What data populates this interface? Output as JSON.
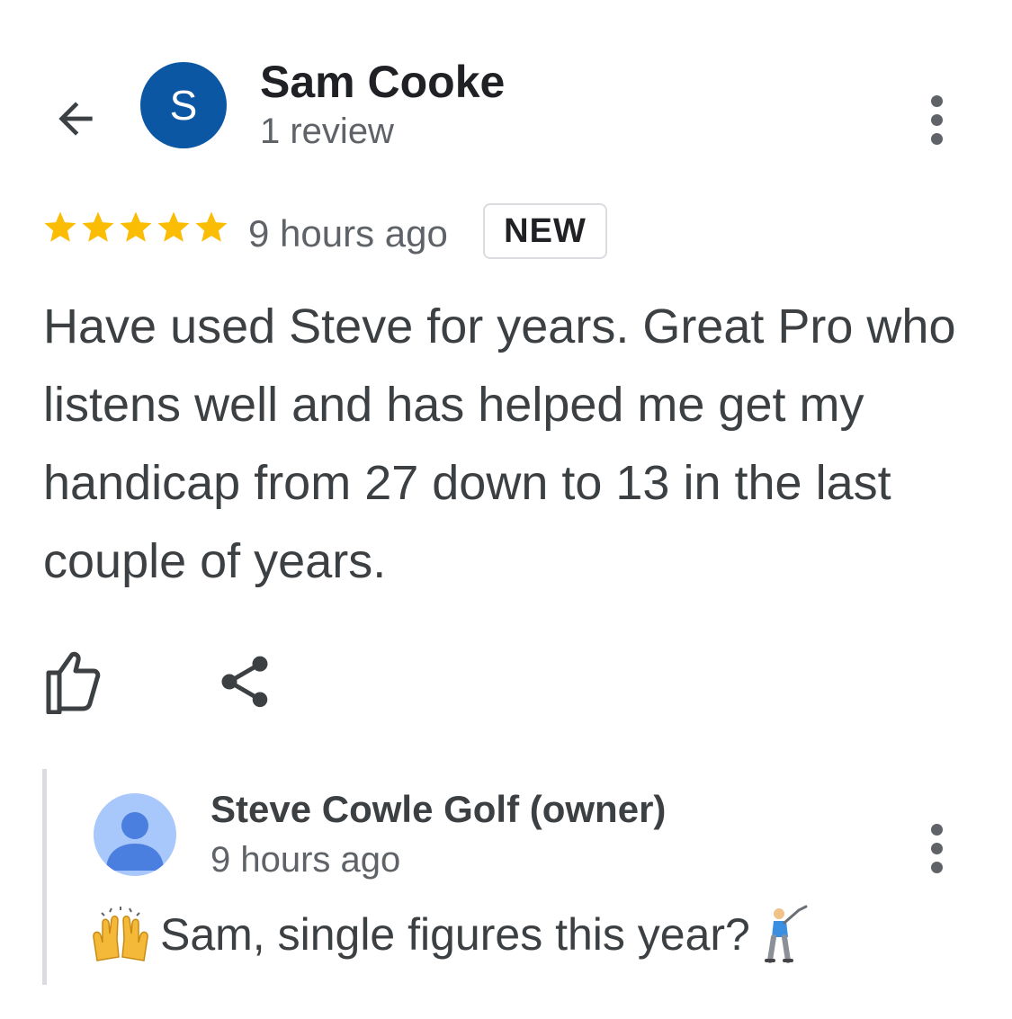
{
  "header": {
    "avatar_initial": "S",
    "reviewer_name": "Sam Cooke",
    "review_count": "1 review"
  },
  "review": {
    "rating": 5,
    "max_rating": 5,
    "time_ago": "9 hours ago",
    "badge": "NEW",
    "text": "Have used Steve for years. Great Pro who listens well and has helped me get my handicap from 27 down to 13 in the last couple of years."
  },
  "owner_reply": {
    "name": "Steve Cowle Golf (owner)",
    "time_ago": "9 hours ago",
    "text": "Sam, single figures this year?"
  },
  "icons": {
    "back": "arrow-back-icon",
    "more": "more-vert-icon",
    "star": "star-icon",
    "like": "thumb-up-icon",
    "share": "share-icon",
    "owner_avatar": "person-icon",
    "leading_emoji": "raising-hands-emoji",
    "trailing_emoji": "golfer-emoji"
  },
  "colors": {
    "star": "#fbbc04",
    "avatar_bg": "#0b57a4",
    "owner_avatar_bg": "#a8c7fa",
    "owner_avatar_fg": "#4a7fe0"
  }
}
